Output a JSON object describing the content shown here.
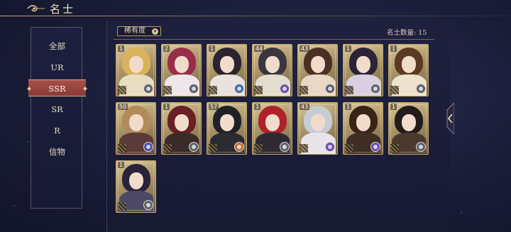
{
  "header": {
    "title": "名士"
  },
  "sidebar": {
    "items": [
      {
        "label": "全部",
        "active": false
      },
      {
        "label": "UR",
        "active": false
      },
      {
        "label": "SSR",
        "active": true
      },
      {
        "label": "SR",
        "active": false
      },
      {
        "label": "R",
        "active": false
      },
      {
        "label": "信物",
        "active": false
      }
    ]
  },
  "toolbar": {
    "sort_label": "稀有度",
    "count_label": "名士数量: 15"
  },
  "cards": [
    {
      "level": "1",
      "hair": "#d9b25a",
      "robe": "#e8dcc2",
      "badge": "#5b6070"
    },
    {
      "level": "2",
      "hair": "#9a2e4a",
      "robe": "#f0e6ea",
      "badge": "#5b6070"
    },
    {
      "level": "1",
      "hair": "#2a2430",
      "robe": "#e9e2de",
      "badge": "#3a67b8"
    },
    {
      "level": "44",
      "hair": "#3a3640",
      "robe": "#e3ddd0",
      "badge": "#6a4bb6"
    },
    {
      "level": "43",
      "hair": "#4a3024",
      "robe": "#ead8c6",
      "badge": "#5b6070"
    },
    {
      "level": "1",
      "hair": "#2c2436",
      "robe": "#d8d0e2",
      "badge": "#5b6070"
    },
    {
      "level": "1",
      "hair": "#5a3a22",
      "robe": "#efe3cf",
      "badge": "#5b6070"
    },
    {
      "level": "50",
      "hair": "#b38a5a",
      "robe": "#5a3a3a",
      "badge": "#4b4bb6"
    },
    {
      "level": "1",
      "hair": "#6a1e26",
      "robe": "#3a2a2a",
      "badge": "#5b6070"
    },
    {
      "level": "57",
      "hair": "#1e2226",
      "robe": "#2a2a30",
      "badge": "#c06a3a"
    },
    {
      "level": "1",
      "hair": "#b0222a",
      "robe": "#2e2a34",
      "badge": "#5b6070"
    },
    {
      "level": "43",
      "hair": "#c6ccd6",
      "robe": "#e8e4ea",
      "badge": "#6a4bb6"
    },
    {
      "level": "1",
      "hair": "#3a2418",
      "robe": "#3e2e24",
      "badge": "#6a4bb6"
    },
    {
      "level": "1",
      "hair": "#221c1a",
      "robe": "#4a3a2e",
      "badge": "#5b6070"
    },
    {
      "level": "1",
      "hair": "#2a2238",
      "robe": "#4e4a66",
      "badge": "#5b6070"
    }
  ]
}
